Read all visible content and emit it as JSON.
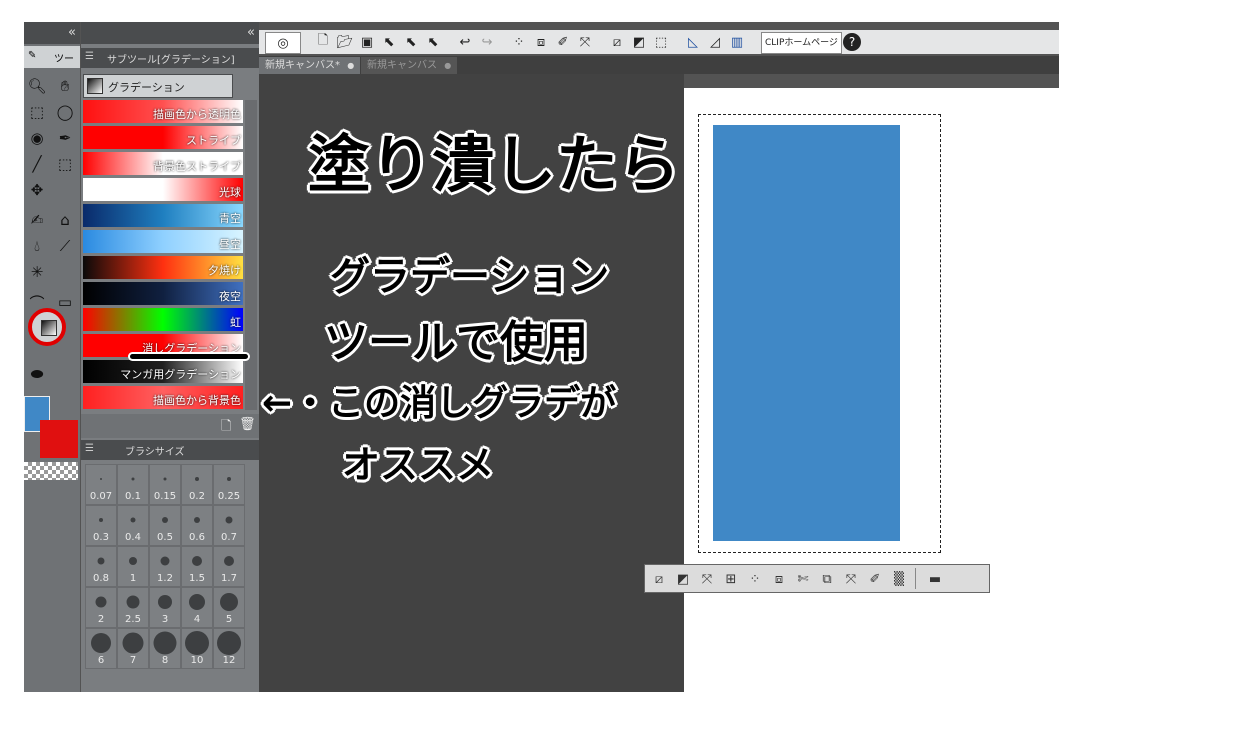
{
  "toolbar": {
    "home_button": "CLIPホームページ",
    "help_button": "?"
  },
  "doc_tabs": [
    {
      "label": "新規キャンバス*",
      "close": "●"
    },
    {
      "label": "新規キャンバス",
      "close": "●"
    }
  ],
  "tool_panel": {
    "tab_label": "ツー"
  },
  "subtool_panel": {
    "header_label": "サブツール[グラデーション]",
    "group_label": "グラデーション",
    "items": [
      {
        "label": "描画色から透明色",
        "colors": [
          "#ff1010",
          "#ff5050",
          "#ffffff"
        ]
      },
      {
        "label": "ストライプ",
        "colors": [
          "#ff0000",
          "#ff0000",
          "#ffffff"
        ]
      },
      {
        "label": "背景色ストライプ",
        "colors": [
          "#ff0000",
          "#ffffff",
          "#ffffff"
        ]
      },
      {
        "label": "光球",
        "colors": [
          "#ffffff",
          "#ffffff",
          "#ff0000"
        ]
      },
      {
        "label": "青空",
        "colors": [
          "#0a2a6a",
          "#1f7fc0",
          "#8ad8ff"
        ]
      },
      {
        "label": "昼空",
        "colors": [
          "#2a8ae0",
          "#8fd0ff",
          "#d8f4ff"
        ]
      },
      {
        "label": "夕焼け",
        "colors": [
          "#0a0a0a",
          "#ff3010",
          "#ffe040"
        ]
      },
      {
        "label": "夜空",
        "colors": [
          "#000000",
          "#102040",
          "#4070c0"
        ]
      },
      {
        "label": "虹",
        "colors": [
          "#ff0000",
          "#00ff00",
          "#0000ff"
        ]
      },
      {
        "label": "消しグラデーション",
        "colors": [
          "#ff0000",
          "#ff0000",
          "#ffffff"
        ]
      },
      {
        "label": "マンガ用グラデーション",
        "colors": [
          "#000000",
          "#202020",
          "#ffffff"
        ]
      },
      {
        "label": "描画色から背景色",
        "colors": [
          "#ff2020",
          "#ff6060",
          "#ff2020"
        ]
      }
    ]
  },
  "brush_panel": {
    "header_label": "ブラシサイズ",
    "sizes": [
      "0.07",
      "0.1",
      "0.15",
      "0.2",
      "0.25",
      "0.3",
      "0.4",
      "0.5",
      "0.6",
      "0.7",
      "0.8",
      "1",
      "1.2",
      "1.5",
      "1.7",
      "2",
      "2.5",
      "3",
      "4",
      "5",
      "6",
      "7",
      "8",
      "10",
      "12"
    ]
  },
  "colors": {
    "main_color": "#4088c6",
    "sub_color": "#e01010",
    "canvas_fill": "#4088c6"
  },
  "annotations": {
    "line1": "塗り潰したら",
    "line2": "グラデーション",
    "line3": "ツールで使用",
    "line4": "←・この消しグラデが",
    "line5": "オススメ"
  }
}
